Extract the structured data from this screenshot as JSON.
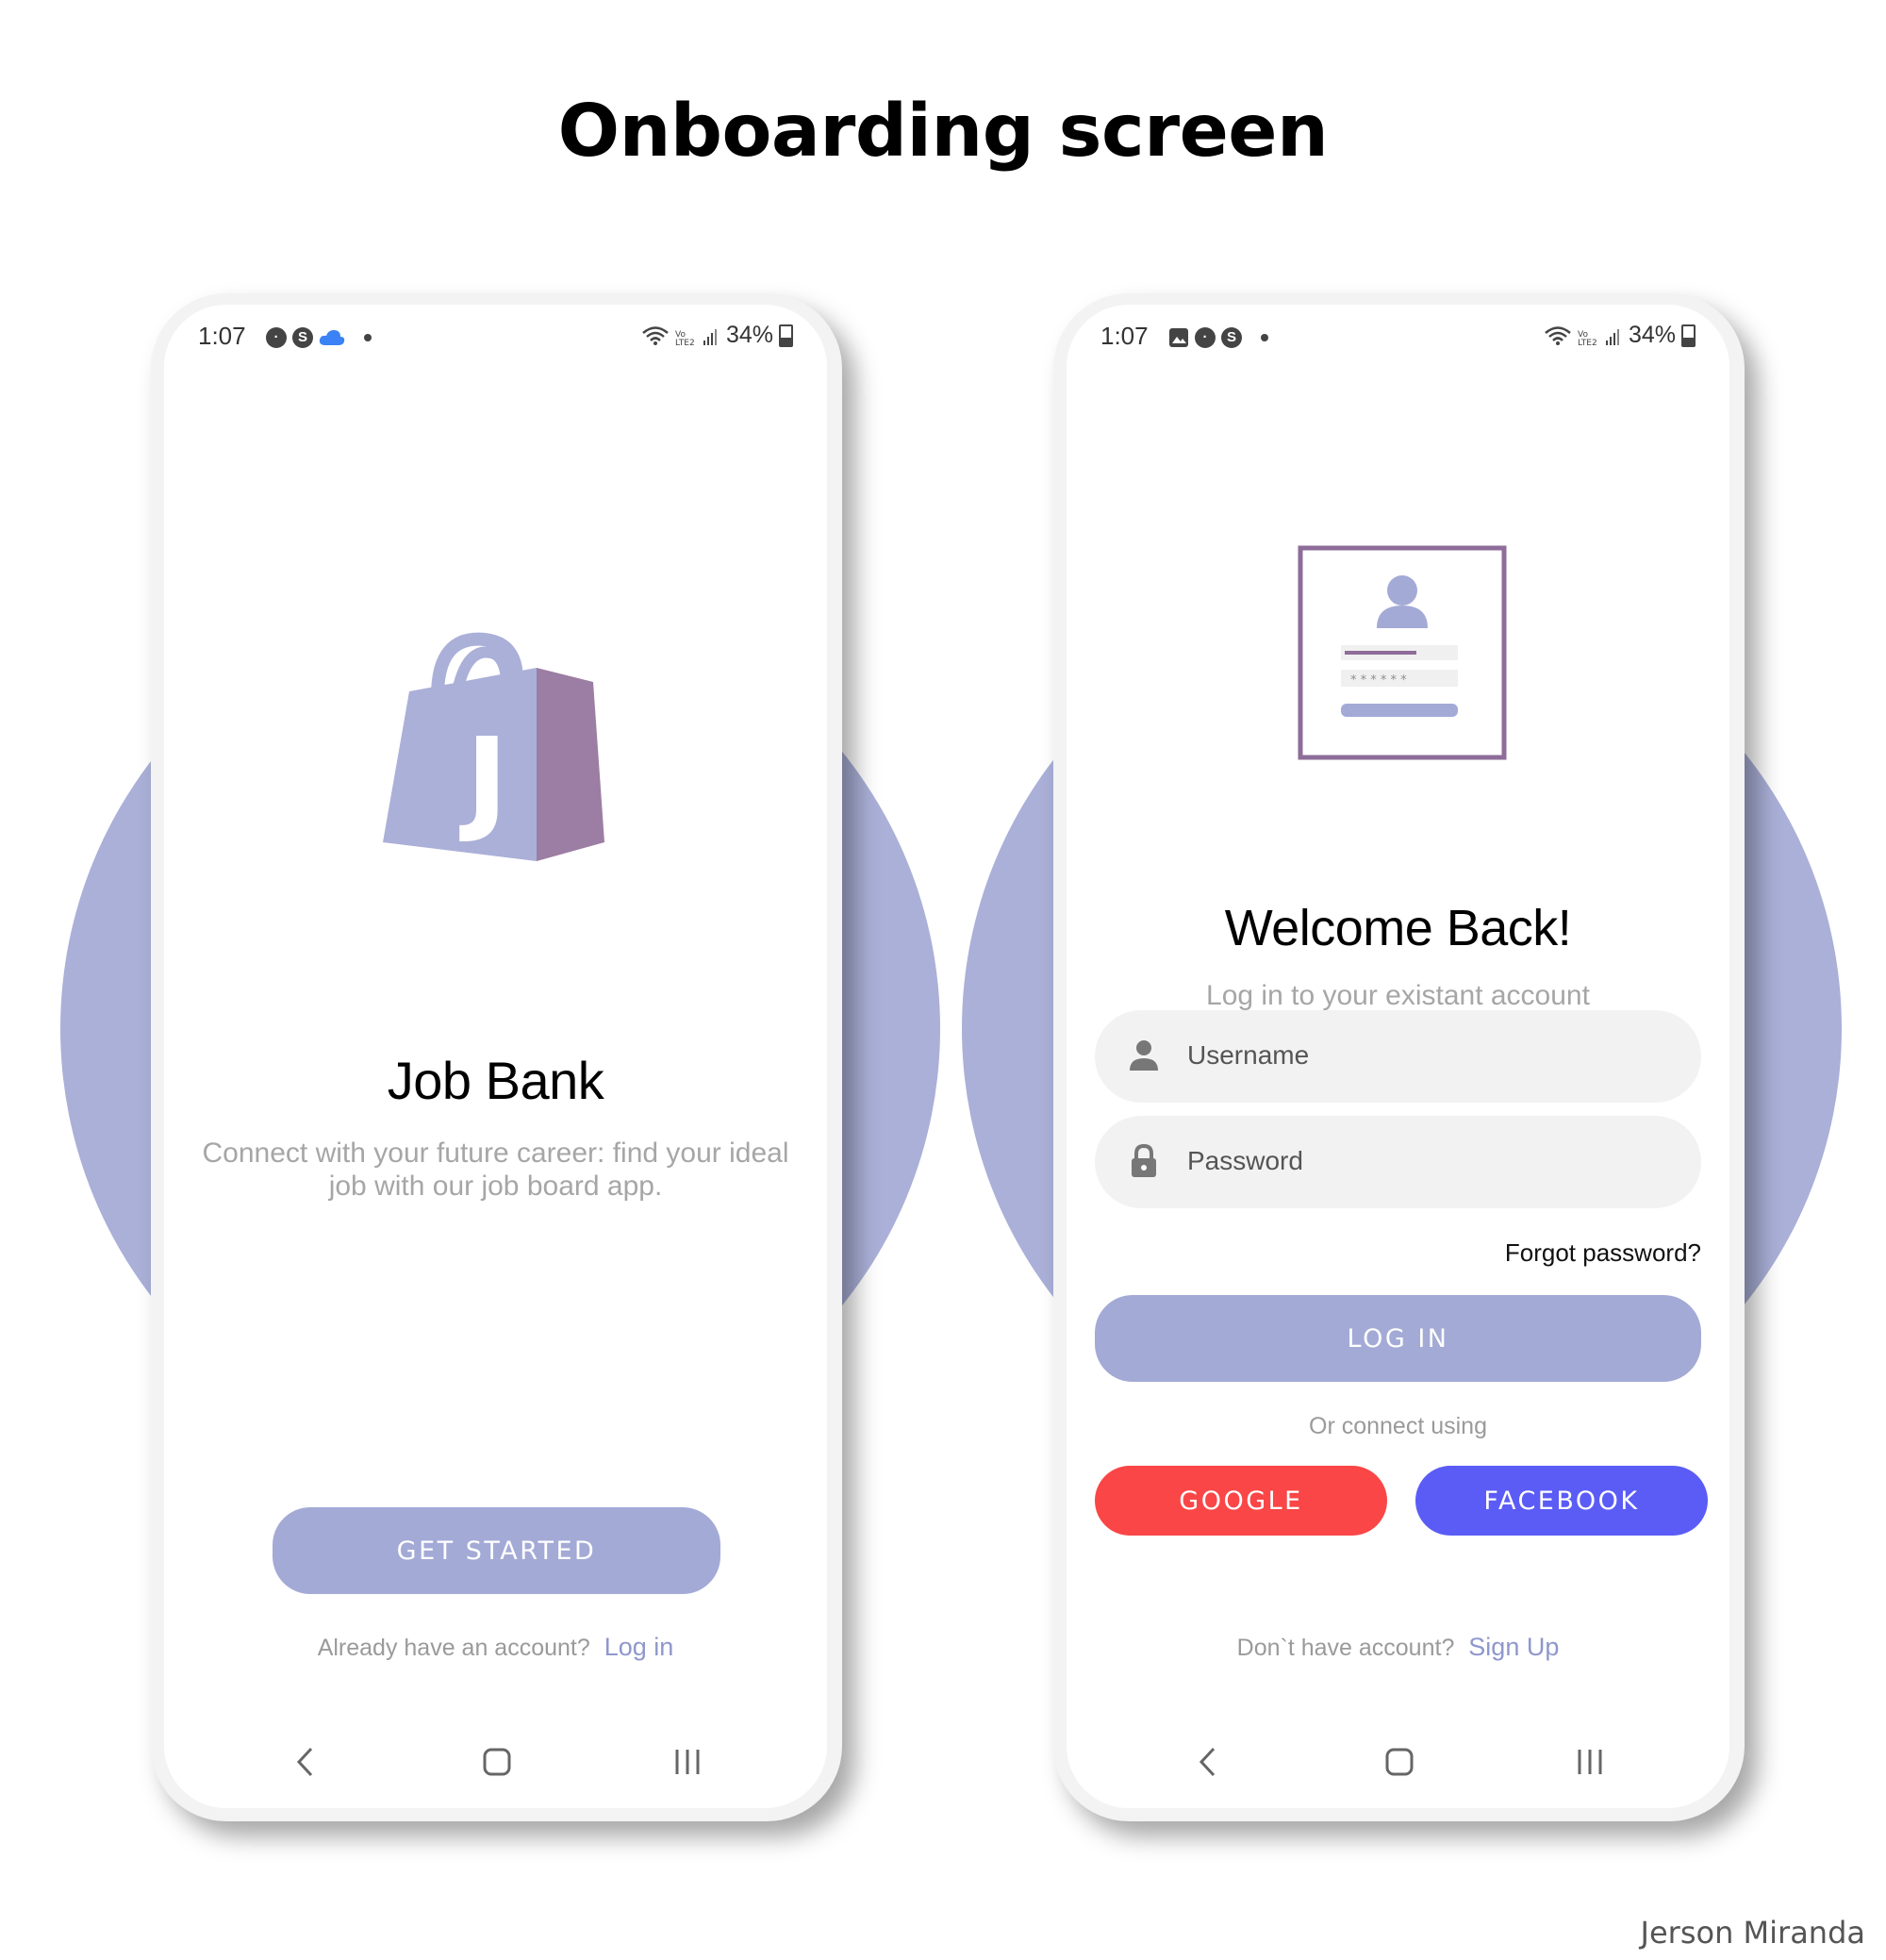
{
  "page_title": "Onboarding screen",
  "author": "Jerson Miranda",
  "colors": {
    "accent_lavender": "#a3aad6",
    "circle_bg": "#aab0d8",
    "logo_purple": "#9c7da3",
    "google_red": "#fa4646",
    "facebook_blue": "#5b5cf6",
    "link": "#8e97cc"
  },
  "left_screen": {
    "status": {
      "time": "1:07",
      "battery": "34%"
    },
    "logo_letter": "J",
    "app_name": "Job Bank",
    "tagline": "Connect with your future career: find your ideal job with our job board app.",
    "cta_label": "GET STARTED",
    "account_prompt": "Already have an account?",
    "login_link": "Log in",
    "nav": [
      "back-icon",
      "home-icon",
      "recents-icon"
    ]
  },
  "right_screen": {
    "status": {
      "time": "1:07",
      "battery": "34%"
    },
    "illustration_password_mask": "* * * * * *",
    "heading": "Welcome Back!",
    "subheading": "Log in to your existant account",
    "username_placeholder": "Username",
    "password_placeholder": "Password",
    "forgot_password": "Forgot password?",
    "login_label": "LOG IN",
    "connect_text": "Or connect using",
    "google_label": "GOOGLE",
    "facebook_label": "FACEBOOK",
    "signup_prompt": "Don`t have account?",
    "signup_link": "Sign Up",
    "nav": [
      "back-icon",
      "home-icon",
      "recents-icon"
    ]
  }
}
